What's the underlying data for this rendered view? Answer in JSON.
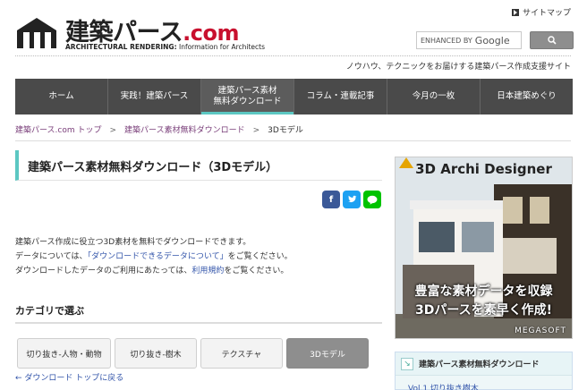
{
  "header": {
    "logo_title": "建築パース",
    "logo_domain": ".com",
    "logo_sub_bold": "ARCHITECTURAL RENDERING:",
    "logo_sub_rest": " Information for Architects",
    "sitemap_label": "サイトマップ",
    "search_placeholder": "ENHANCED BY",
    "search_google": "Google",
    "tagline": "ノウハウ、テクニックをお届けする建築パース作成支援サイト"
  },
  "nav": {
    "items": [
      {
        "label": "ホーム"
      },
      {
        "label": "実践！建築パース"
      },
      {
        "label": "建築パース素材\n無料ダウンロード"
      },
      {
        "label": "コラム・連載記事"
      },
      {
        "label": "今月の一枚"
      },
      {
        "label": "日本建築めぐり"
      }
    ],
    "active_index": 2
  },
  "breadcrumb": {
    "items": [
      "建築パース.com トップ",
      "建築パース素材無料ダウンロード",
      "3Dモデル"
    ],
    "separator": ">"
  },
  "main": {
    "title": "建築パース素材無料ダウンロード（3Dモデル）",
    "share": {
      "facebook": "f",
      "twitter": "t",
      "line": "L"
    },
    "intro_line1": "建築パース作成に役立つ3D素材を無料でダウンロードできます。",
    "intro_line2_pre": "データについては、",
    "intro_line2_link": "「ダウンロードできるデータについて」",
    "intro_line2_post": "をご覧ください。",
    "intro_line3_pre": "ダウンロードしたデータのご利用にあたっては、",
    "intro_line3_link": "利用規約",
    "intro_line3_post": "をご覧ください。",
    "category_heading": "カテゴリで選ぶ",
    "categories": [
      {
        "label": "切り抜き-人物・動物"
      },
      {
        "label": "切り抜き-樹木"
      },
      {
        "label": "テクスチャ"
      },
      {
        "label": "3Dモデル"
      }
    ],
    "active_category": 3,
    "back_link": "← ダウンロード トップに戻る"
  },
  "sidebar": {
    "ad_title": "3D Archi Designer",
    "ad_copy1": "豊富な素材データを収録",
    "ad_copy2": "3Dパースを素早く作成!",
    "ad_brand": "MEGASOFT",
    "box_heading": "建築パース素材無料ダウンロード",
    "box_item": "Vol.1 切り抜き樹木"
  },
  "colors": {
    "accent": "#5cc7c2",
    "nav_bg": "#4a4a4a",
    "link": "#3355aa",
    "breadcrumb_link": "#7a3f7a",
    "brand_red": "#c8102e"
  }
}
